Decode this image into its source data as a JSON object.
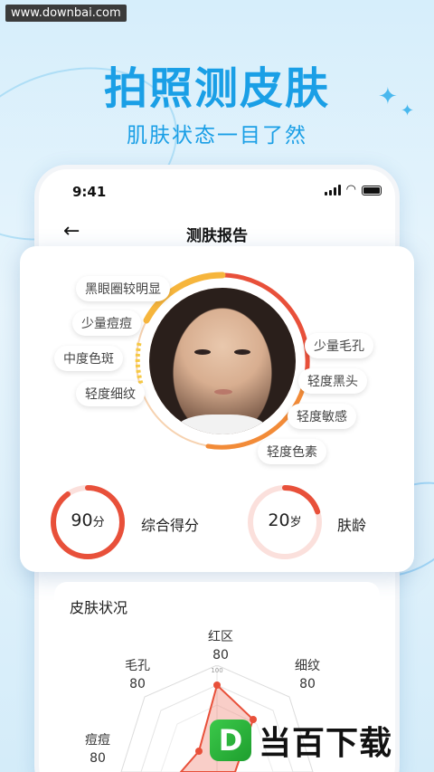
{
  "watermark": "www.downbai.com",
  "hero": {
    "title": "拍照测皮肤",
    "subtitle": "肌肤状态一目了然"
  },
  "status_bar": {
    "time": "9:41"
  },
  "nav": {
    "title": "测肤报告"
  },
  "tags_left": [
    "黑眼圈较明显",
    "少量痘痘",
    "中度色斑",
    "轻度细纹"
  ],
  "tags_right": [
    "少量毛孔",
    "轻度黑头",
    "轻度敏感",
    "轻度色素"
  ],
  "scores": {
    "overall": {
      "value": "90",
      "unit": "分",
      "label": "综合得分",
      "fraction": 0.9
    },
    "age": {
      "value": "20",
      "unit": "岁",
      "label": "肤龄",
      "fraction": 0.2
    }
  },
  "skin_status": {
    "title": "皮肤状况",
    "radar_labels": [
      {
        "name": "红区",
        "value": "80"
      },
      {
        "name": "细纹",
        "value": "80"
      },
      {
        "name": "毛孔",
        "value": "80"
      },
      {
        "name": "痘痘",
        "value": "80"
      }
    ],
    "scale_label": "100"
  },
  "logo": {
    "badge": "D",
    "text": "当百下载"
  },
  "colors": {
    "accent": "#1a9fe6",
    "score_red": "#e8503a",
    "ring_orange": "#f4a23c"
  }
}
